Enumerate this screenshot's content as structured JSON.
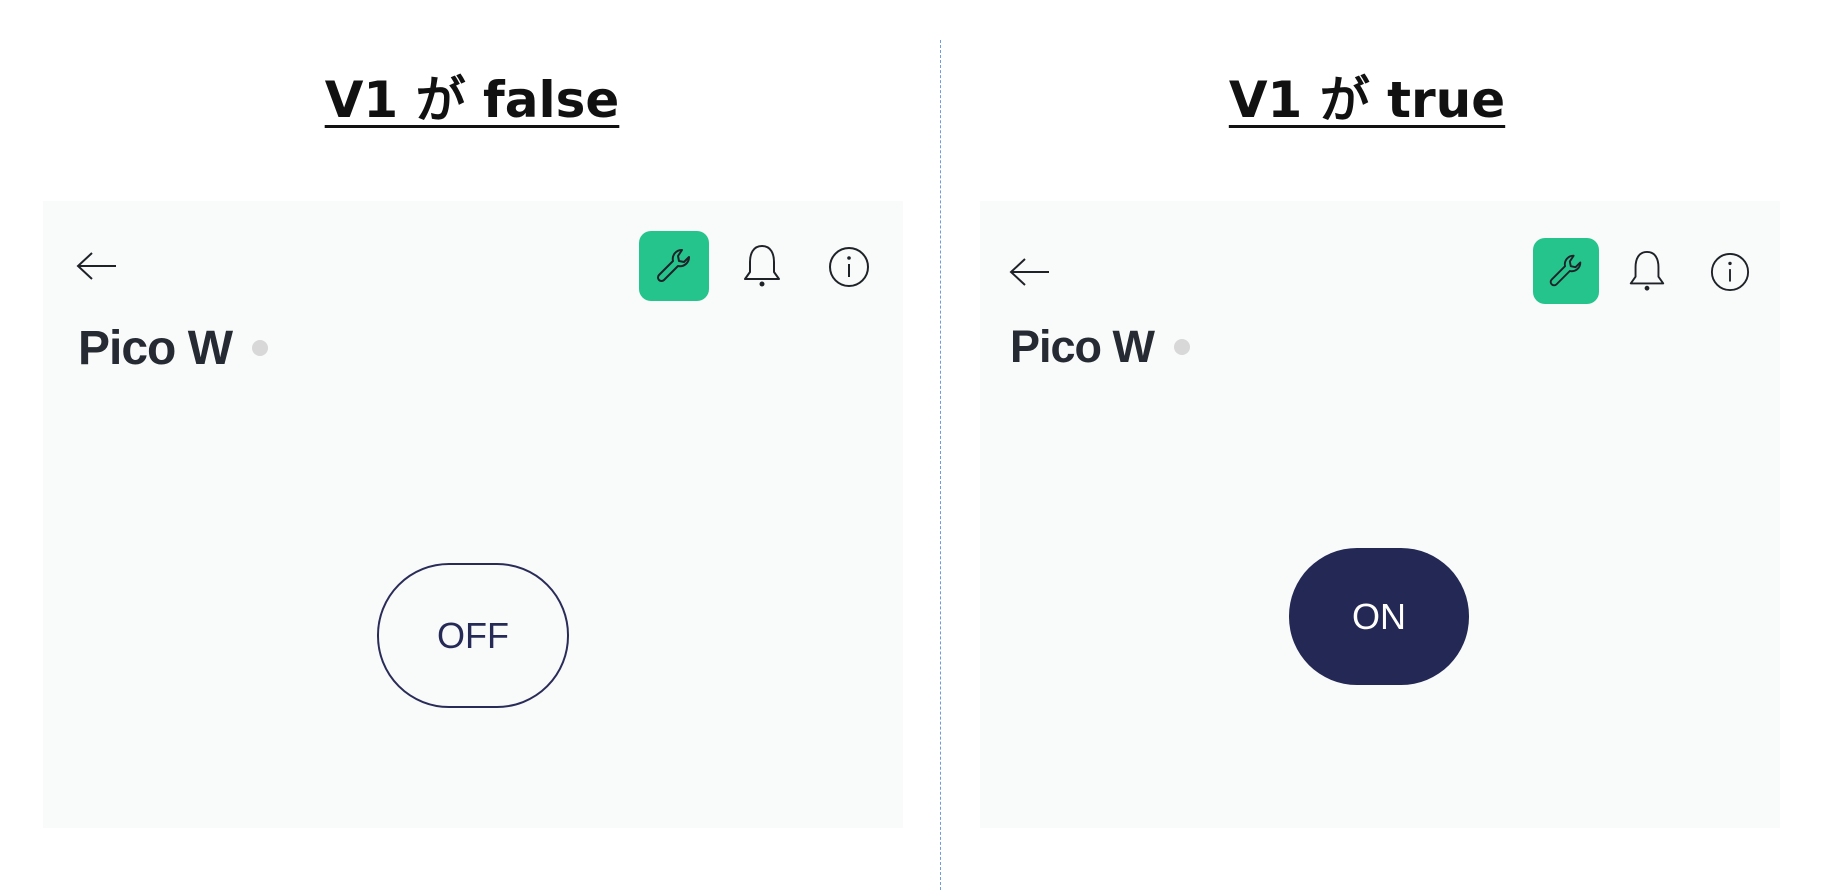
{
  "left": {
    "heading": "V1 が false",
    "device_name": "Pico W",
    "switch_label": "OFF"
  },
  "right": {
    "heading": "V1 が true",
    "device_name": "Pico W",
    "switch_label": "ON"
  },
  "icons": [
    "back-arrow-icon",
    "wrench-icon",
    "bell-icon",
    "info-icon"
  ],
  "colors": {
    "accent_green": "#25c48d",
    "switch_navy": "#242854",
    "panel_bg": "#f9fafa",
    "status_dot": "#d8d8d8",
    "divider": "#6f9be0"
  }
}
